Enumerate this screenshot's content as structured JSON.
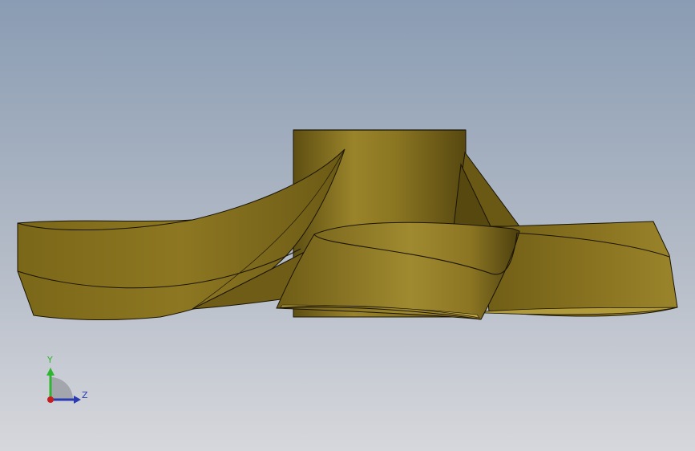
{
  "viewport": {
    "background_top": "#8a9cb3",
    "background_bottom": "#d6d7dc"
  },
  "model": {
    "name": "impeller",
    "color_light": "#a08a2e",
    "color_mid": "#7d6a1c",
    "color_dark": "#514410",
    "edge_color": "#1a1404"
  },
  "triad": {
    "y_label": "Y",
    "z_label": "Z",
    "y_color": "#2fb52f",
    "z_color": "#2a3bb0",
    "x_color": "#c41e1e"
  }
}
